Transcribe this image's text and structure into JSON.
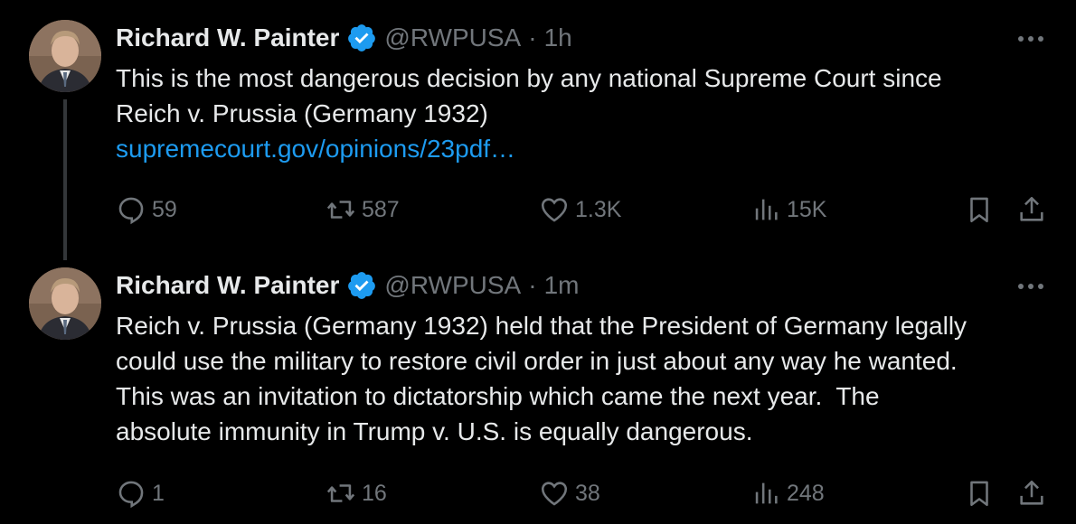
{
  "tweets": [
    {
      "author": "Richard W. Painter",
      "handle": "@RWPUSA",
      "separator": "·",
      "time": "1h",
      "lines": [
        "This is the most dangerous decision by any national Supreme Court since",
        "Reich v. Prussia (Germany 1932)"
      ],
      "link": "supremecourt.gov/opinions/23pdf…",
      "stats": {
        "replies": "59",
        "retweets": "587",
        "likes": "1.3K",
        "views": "15K"
      }
    },
    {
      "author": "Richard W. Painter",
      "handle": "@RWPUSA",
      "separator": "·",
      "time": "1m",
      "lines": [
        "Reich v. Prussia (Germany 1932) held that the President of Germany legally",
        "could use the military to restore civil order in just about any way he wanted.",
        "This was an invitation to dictatorship which came the next year.  The",
        "absolute immunity in Trump v. U.S. is equally dangerous."
      ],
      "stats": {
        "replies": "1",
        "retweets": "16",
        "likes": "38",
        "views": "248"
      }
    }
  ],
  "colors": {
    "background": "#000000",
    "text": "#e7e9ea",
    "muted": "#71767b",
    "link": "#1d9bf0",
    "verified": "#1d9bf0",
    "thread_line": "#333639"
  },
  "icons": [
    "verified-badge-icon",
    "more-icon",
    "reply-icon",
    "retweet-icon",
    "like-icon",
    "views-icon",
    "bookmark-icon",
    "share-icon"
  ]
}
